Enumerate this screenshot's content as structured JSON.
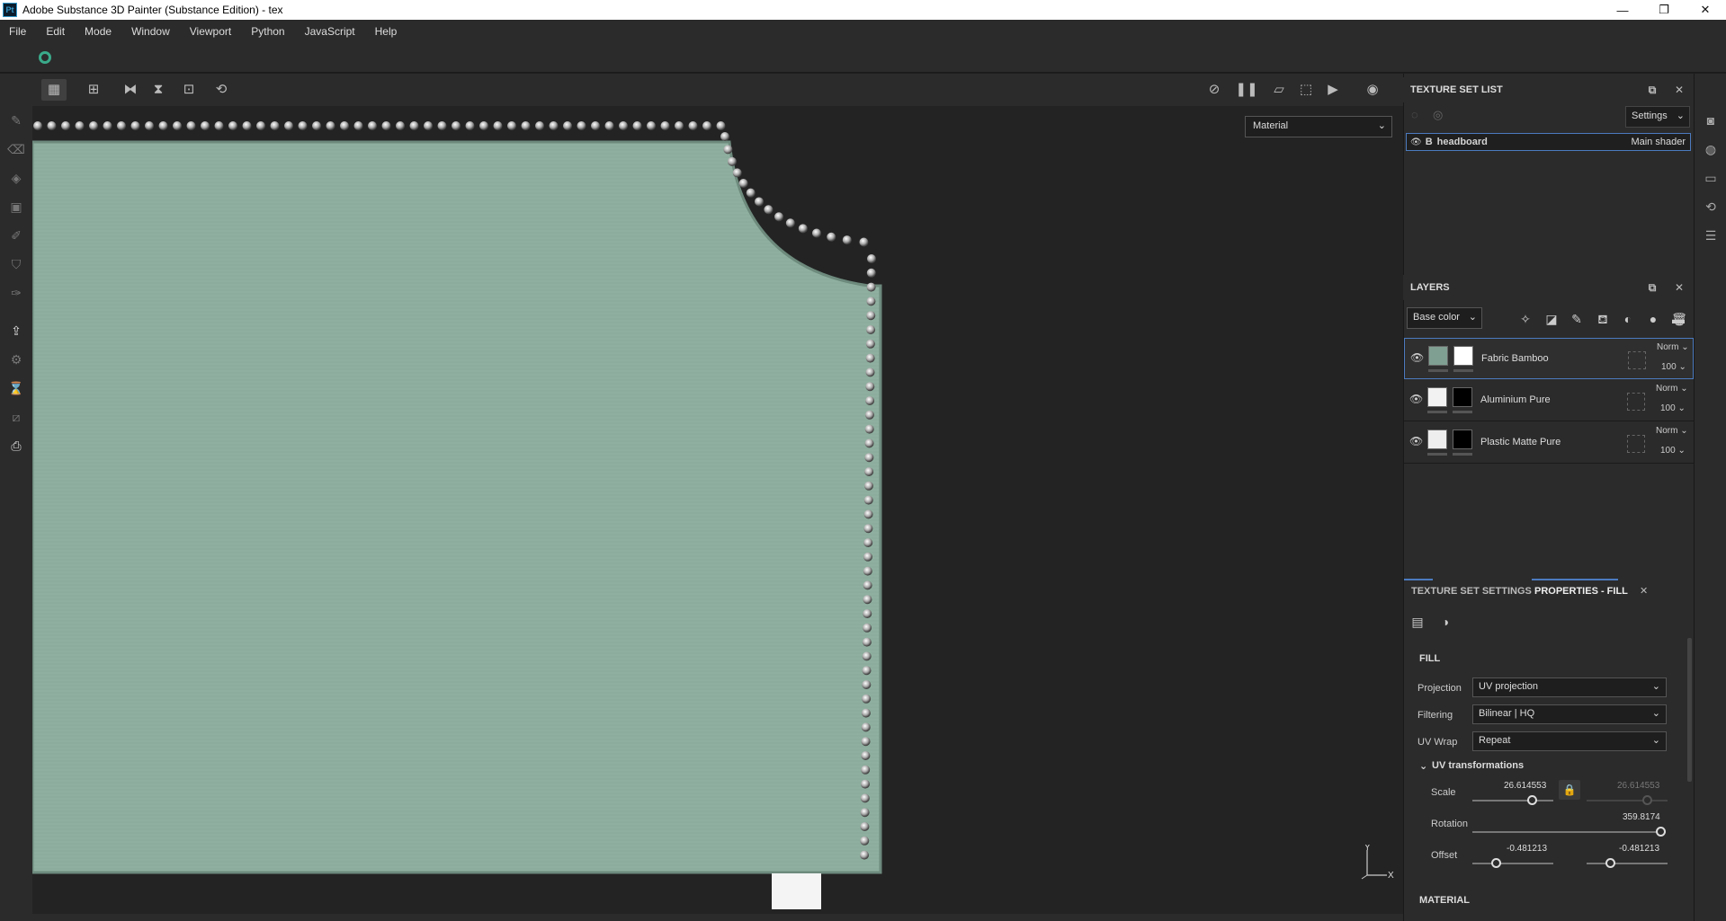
{
  "window": {
    "app_icon": "Pt",
    "title": "Adobe Substance 3D Painter (Substance Edition) - tex",
    "minimize": "—",
    "maximize": "❐",
    "close": "✕"
  },
  "menu": [
    "File",
    "Edit",
    "Mode",
    "Window",
    "Viewport",
    "Python",
    "JavaScript",
    "Help"
  ],
  "viewport": {
    "display_select": "Material",
    "axis_y": "Y",
    "axis_x": "X",
    "fabric_color": "#8fb0a0",
    "stud_color": "#c8c8c8"
  },
  "texture_set_list": {
    "title": "TEXTURE SET LIST",
    "settings_label": "Settings",
    "item": {
      "prefix": "B",
      "name": "headboard",
      "shader": "Main shader"
    }
  },
  "layers": {
    "title": "LAYERS",
    "channel_select": "Base color",
    "items": [
      {
        "name": "Fabric Bamboo",
        "blend": "Norm",
        "opacity": "100",
        "selected": true,
        "thumb_color": "#7f9f92",
        "mask_color": "#ffffff"
      },
      {
        "name": "Aluminium Pure",
        "blend": "Norm",
        "opacity": "100",
        "selected": false,
        "thumb_color": "#f2f2f2",
        "mask_color": "#000000"
      },
      {
        "name": "Plastic Matte Pure",
        "blend": "Norm",
        "opacity": "100",
        "selected": false,
        "thumb_color": "#eeeeee",
        "mask_color": "#000000"
      }
    ]
  },
  "properties": {
    "tab_texture_set_settings": "TEXTURE SET SETTINGS",
    "tab_properties_fill": "PROPERTIES - FILL",
    "fill_section": "FILL",
    "projection_label": "Projection",
    "projection_value": "UV projection",
    "filtering_label": "Filtering",
    "filtering_value": "Bilinear | HQ",
    "uvwrap_label": "UV Wrap",
    "uvwrap_value": "Repeat",
    "uv_transformations": "UV transformations",
    "scale_label": "Scale",
    "scale_value_1": "26.614553",
    "scale_value_2": "26.614553",
    "rotation_label": "Rotation",
    "rotation_value": "359.8174",
    "offset_label": "Offset",
    "offset_value_1": "-0.481213",
    "offset_value_2": "-0.481213",
    "material_section": "MATERIAL"
  },
  "colors": {
    "accent": "#4b7bbf",
    "panel_bg": "#2b2b2b",
    "viewport_bg": "#232323"
  }
}
